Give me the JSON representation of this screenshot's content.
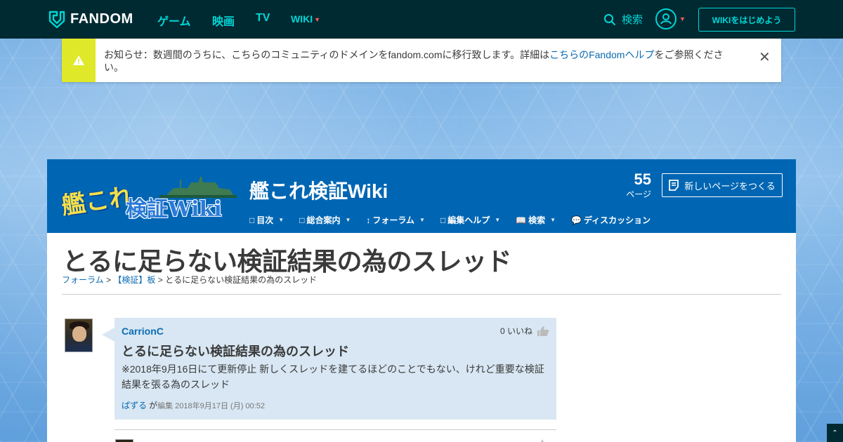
{
  "global_nav": {
    "logo_text": "FANDOM",
    "links": [
      "ゲーム",
      "映画",
      "TV"
    ],
    "wiki_link": "WIKI",
    "search_label": "検索",
    "start_wiki": "WIKIをはじめよう",
    "colors": {
      "bar": "#002a32",
      "link": "#00d6d6",
      "caret": "#ff5e5e"
    }
  },
  "banner": {
    "text_before": "お知らせ：数週間のうちに、こちらのコミュニティのドメインをfandom.comに移行致します。詳細は",
    "link_text": "こちらのFandomヘルプ",
    "text_after": "をご参照ください。",
    "close_icon": "close-icon"
  },
  "community": {
    "logo_line1": "艦これ",
    "logo_line2": "検証Wiki",
    "title": "艦これ検証Wiki",
    "page_count": "55",
    "page_count_label": "ページ",
    "new_page_button": "新しいページをつくる",
    "nav": [
      "目次",
      "総合案内",
      "フォーラム",
      "編集ヘルプ",
      "検索",
      "ディスカッション"
    ],
    "nav_icons": [
      "□",
      "□",
      "↕",
      "□",
      "📖",
      "💬"
    ],
    "colors": {
      "header_bg": "#0066b3"
    }
  },
  "article": {
    "title": "とるに足らない検証結果の為のスレッド",
    "breadcrumb": {
      "link1": "フォーラム",
      "sep1": ">",
      "link2": "【検証】板",
      "sep2": ">",
      "current": "とるに足らない検証結果の為のスレッド"
    }
  },
  "message": {
    "author": "CarrionC",
    "likes": "0 いいね",
    "title": "とるに足らない検証結果の為のスレッド",
    "body": "※2018年9月16日にて更新停止 新しくスレッドを建てるほどのことでもない、けれど重要な検証結果を張る為のスレッド",
    "edited_by": "ぱずる",
    "edited_ga": "が",
    "edited_label": "編集",
    "edited_at": "2018年9月17日 (月) 00:52"
  }
}
